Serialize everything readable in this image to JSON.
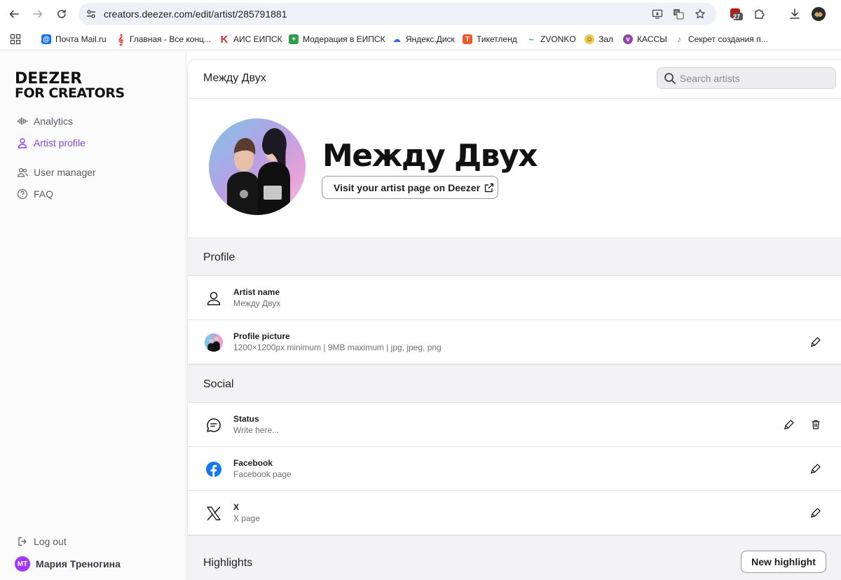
{
  "browser": {
    "url": "creators.deezer.com/edit/artist/285791881",
    "badge_count": "27",
    "bookmarks": [
      {
        "label": "Почта Mail.ru",
        "color": "#1a73e8"
      },
      {
        "label": "Главная - Все конц...",
        "color": "#e53935"
      },
      {
        "label": "АИС ЕИПСК",
        "color": "#d32f2f"
      },
      {
        "label": "Модерация в ЕИПСК",
        "color": "#2e9e48"
      },
      {
        "label": "Яндекс.Диск",
        "color": "#2d6cdf"
      },
      {
        "label": "Тикетленд",
        "color": "#f05a28"
      },
      {
        "label": "ZVONKO",
        "color": "#1ec0a4"
      },
      {
        "label": "Зал",
        "color": "#f2c94c"
      },
      {
        "label": "КАССЫ",
        "color": "#8e44ad"
      },
      {
        "label": "Секрет создания п...",
        "color": "#888888"
      }
    ]
  },
  "sidebar": {
    "logo_line1": "DEEZER",
    "logo_line2": "FOR CREATORS",
    "items": [
      {
        "label": "Analytics",
        "icon": "waveform-icon"
      },
      {
        "label": "Artist profile",
        "icon": "person-icon",
        "active": true
      },
      {
        "label": "User manager",
        "icon": "users-icon"
      },
      {
        "label": "FAQ",
        "icon": "help-icon"
      }
    ],
    "logout_label": "Log out",
    "user_initials": "МТ",
    "user_name": "Мария Треногина"
  },
  "topbar": {
    "title": "Между Двух",
    "search_placeholder": "Search artists"
  },
  "hero": {
    "artist_name": "Между Двух",
    "visit_label": "Visit your artist page on Deezer"
  },
  "profile": {
    "section_title": "Profile",
    "rows": [
      {
        "title": "Artist name",
        "subtitle": "Между Двух"
      },
      {
        "title": "Profile picture",
        "subtitle": "1200×1200px minimum | 9MB maximum | jpg, jpeg, png"
      }
    ]
  },
  "social": {
    "section_title": "Social",
    "rows": [
      {
        "title": "Status",
        "subtitle": "Write here..."
      },
      {
        "title": "Facebook",
        "subtitle": "Facebook page"
      },
      {
        "title": "X",
        "subtitle": "X page"
      }
    ]
  },
  "highlights": {
    "section_title": "Highlights",
    "new_label": "New highlight"
  },
  "colors": {
    "accent": "#8a3ffc",
    "facebook": "#1877f2",
    "avatar": "#a238ff"
  }
}
